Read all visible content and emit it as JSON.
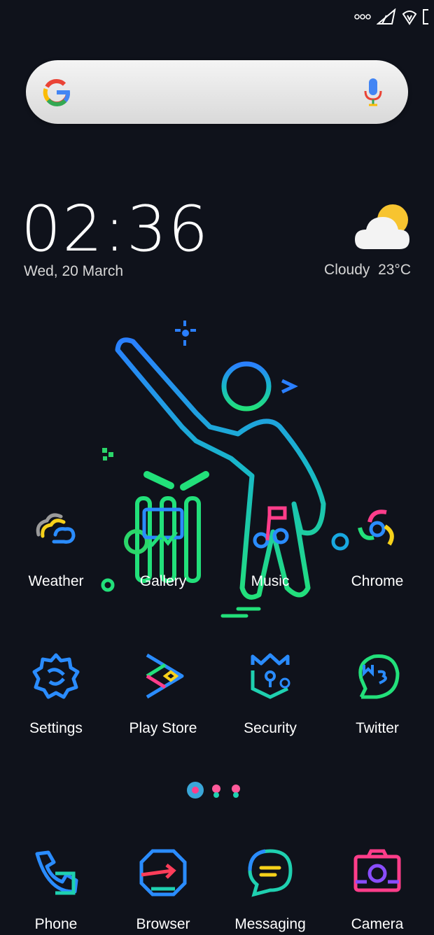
{
  "clock": {
    "time": "02:36",
    "date": "Wed, 20 March"
  },
  "weather_widget": {
    "condition": "Cloudy",
    "temperature": "23°C",
    "icon": "cloudy-icon"
  },
  "search": {
    "icon": "google-g-icon",
    "mic_icon": "mic-icon"
  },
  "apps_row1": [
    {
      "label": "Weather",
      "icon": "weather-icon"
    },
    {
      "label": "Gallery",
      "icon": "gallery-icon"
    },
    {
      "label": "Music",
      "icon": "music-icon"
    },
    {
      "label": "Chrome",
      "icon": "chrome-icon"
    }
  ],
  "apps_row2": [
    {
      "label": "Settings",
      "icon": "settings-icon"
    },
    {
      "label": "Play Store",
      "icon": "play-store-icon"
    },
    {
      "label": "Security",
      "icon": "security-icon"
    },
    {
      "label": "Twitter",
      "icon": "twitter-icon"
    }
  ],
  "dock": [
    {
      "label": "Phone",
      "icon": "phone-icon"
    },
    {
      "label": "Browser",
      "icon": "browser-icon"
    },
    {
      "label": "Messaging",
      "icon": "messaging-icon"
    },
    {
      "label": "Camera",
      "icon": "camera-icon"
    }
  ],
  "pager": {
    "pages": 3,
    "current": 1
  }
}
